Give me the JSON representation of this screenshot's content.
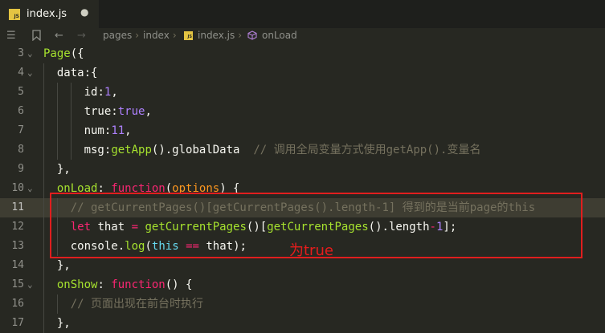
{
  "tab": {
    "title": "index.js",
    "close": "●",
    "badge": "JS"
  },
  "breadcrumb": {
    "items": [
      "pages",
      "index",
      "index.js",
      "onLoad"
    ]
  },
  "colors": {
    "comment": "#75715e",
    "keyword": "#f92672",
    "function": "#a6e22e",
    "number": "#ae81ff",
    "string": "#e6db74",
    "param": "#fd971f",
    "this": "#66d9ef",
    "annotation": "#e01e1e"
  },
  "code_lines": [
    {
      "num": "3",
      "fold": "⌄",
      "segments": [
        {
          "t": "Page",
          "c": "function"
        },
        {
          "t": "({",
          "c": "punct"
        }
      ]
    },
    {
      "num": "4",
      "fold": "⌄",
      "segments": [
        {
          "t": "  "
        },
        {
          "t": "data",
          "c": "plain"
        },
        {
          "t": ":{",
          "c": "punct"
        }
      ]
    },
    {
      "num": "5",
      "fold": "",
      "segments": [
        {
          "t": "      "
        },
        {
          "t": "id",
          "c": "plain"
        },
        {
          "t": ":",
          "c": "punct"
        },
        {
          "t": "1",
          "c": "number"
        },
        {
          "t": ",",
          "c": "punct"
        }
      ]
    },
    {
      "num": "6",
      "fold": "",
      "segments": [
        {
          "t": "      "
        },
        {
          "t": "true",
          "c": "plain"
        },
        {
          "t": ":",
          "c": "punct"
        },
        {
          "t": "true",
          "c": "number"
        },
        {
          "t": ",",
          "c": "punct"
        }
      ]
    },
    {
      "num": "7",
      "fold": "",
      "segments": [
        {
          "t": "      "
        },
        {
          "t": "num",
          "c": "plain"
        },
        {
          "t": ":",
          "c": "punct"
        },
        {
          "t": "11",
          "c": "number"
        },
        {
          "t": ",",
          "c": "punct"
        }
      ]
    },
    {
      "num": "8",
      "fold": "",
      "segments": [
        {
          "t": "      "
        },
        {
          "t": "msg",
          "c": "plain"
        },
        {
          "t": ":",
          "c": "punct"
        },
        {
          "t": "getApp",
          "c": "function"
        },
        {
          "t": "()",
          "c": "punct"
        },
        {
          "t": ".globalData  ",
          "c": "plain"
        },
        {
          "t": "// 调用全局变量方式使用getApp().变量名",
          "c": "comment"
        }
      ]
    },
    {
      "num": "9",
      "fold": "",
      "segments": [
        {
          "t": "  "
        },
        {
          "t": "},",
          "c": "punct"
        }
      ]
    },
    {
      "num": "10",
      "fold": "⌄",
      "segments": [
        {
          "t": "  "
        },
        {
          "t": "onLoad",
          "c": "function"
        },
        {
          "t": ": ",
          "c": "punct"
        },
        {
          "t": "function",
          "c": "keyword"
        },
        {
          "t": "(",
          "c": "punct"
        },
        {
          "t": "options",
          "c": "param"
        },
        {
          "t": ") {",
          "c": "punct"
        }
      ]
    },
    {
      "num": "11",
      "fold": "",
      "current": true,
      "segments": [
        {
          "t": "    "
        },
        {
          "t": "// getCurrentPages()[getCurrentPages().length-1] 得到的是当前page的this",
          "c": "comment"
        }
      ]
    },
    {
      "num": "12",
      "fold": "",
      "segments": [
        {
          "t": "    "
        },
        {
          "t": "let",
          "c": "keyword"
        },
        {
          "t": " that ",
          "c": "plain"
        },
        {
          "t": "=",
          "c": "keyword"
        },
        {
          "t": " ",
          "c": "plain"
        },
        {
          "t": "getCurrentPages",
          "c": "function"
        },
        {
          "t": "()[",
          "c": "punct"
        },
        {
          "t": "getCurrentPages",
          "c": "function"
        },
        {
          "t": "().",
          "c": "punct"
        },
        {
          "t": "length",
          "c": "plain"
        },
        {
          "t": "-",
          "c": "keyword"
        },
        {
          "t": "1",
          "c": "number"
        },
        {
          "t": "];",
          "c": "punct"
        }
      ]
    },
    {
      "num": "13",
      "fold": "",
      "segments": [
        {
          "t": "    "
        },
        {
          "t": "console",
          "c": "plain"
        },
        {
          "t": ".",
          "c": "punct"
        },
        {
          "t": "log",
          "c": "function"
        },
        {
          "t": "(",
          "c": "punct"
        },
        {
          "t": "this",
          "c": "this"
        },
        {
          "t": " ",
          "c": "plain"
        },
        {
          "t": "==",
          "c": "keyword"
        },
        {
          "t": " that);",
          "c": "plain"
        }
      ]
    },
    {
      "num": "14",
      "fold": "",
      "segments": [
        {
          "t": "  "
        },
        {
          "t": "},",
          "c": "punct"
        }
      ]
    },
    {
      "num": "15",
      "fold": "⌄",
      "segments": [
        {
          "t": "  "
        },
        {
          "t": "onShow",
          "c": "function"
        },
        {
          "t": ": ",
          "c": "punct"
        },
        {
          "t": "function",
          "c": "keyword"
        },
        {
          "t": "() {",
          "c": "punct"
        }
      ]
    },
    {
      "num": "16",
      "fold": "",
      "segments": [
        {
          "t": "    "
        },
        {
          "t": "// 页面出现在前台时执行",
          "c": "comment"
        }
      ]
    },
    {
      "num": "17",
      "fold": "",
      "segments": [
        {
          "t": "  "
        },
        {
          "t": "},",
          "c": "punct"
        }
      ]
    }
  ],
  "annotation": {
    "text": "为true"
  }
}
